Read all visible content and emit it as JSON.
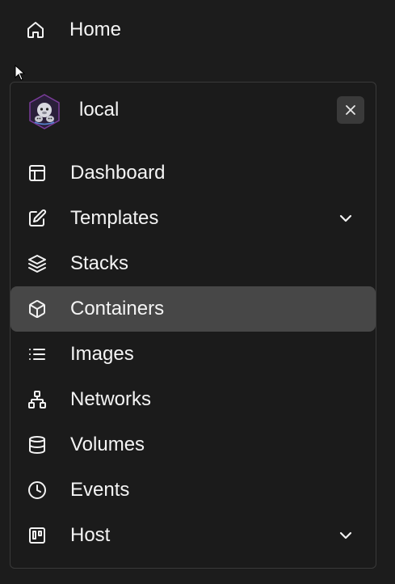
{
  "home": {
    "label": "Home",
    "icon": "home-icon"
  },
  "environment": {
    "name": "local",
    "logo_icon": "portainer-logo-icon",
    "close_icon": "close-icon"
  },
  "menu": {
    "items": [
      {
        "label": "Dashboard",
        "icon": "layout-icon",
        "expandable": false,
        "active": false
      },
      {
        "label": "Templates",
        "icon": "edit-icon",
        "expandable": true,
        "active": false
      },
      {
        "label": "Stacks",
        "icon": "layers-icon",
        "expandable": false,
        "active": false
      },
      {
        "label": "Containers",
        "icon": "box-icon",
        "expandable": false,
        "active": true
      },
      {
        "label": "Images",
        "icon": "list-icon",
        "expandable": false,
        "active": false
      },
      {
        "label": "Networks",
        "icon": "network-icon",
        "expandable": false,
        "active": false
      },
      {
        "label": "Volumes",
        "icon": "database-icon",
        "expandable": false,
        "active": false
      },
      {
        "label": "Events",
        "icon": "clock-icon",
        "expandable": false,
        "active": false
      },
      {
        "label": "Host",
        "icon": "trello-icon",
        "expandable": true,
        "active": false
      }
    ]
  },
  "colors": {
    "background": "#1c1c1c",
    "active_background": "#474747",
    "text": "#f4f4f4",
    "close_button_background": "#3a3a3a"
  }
}
